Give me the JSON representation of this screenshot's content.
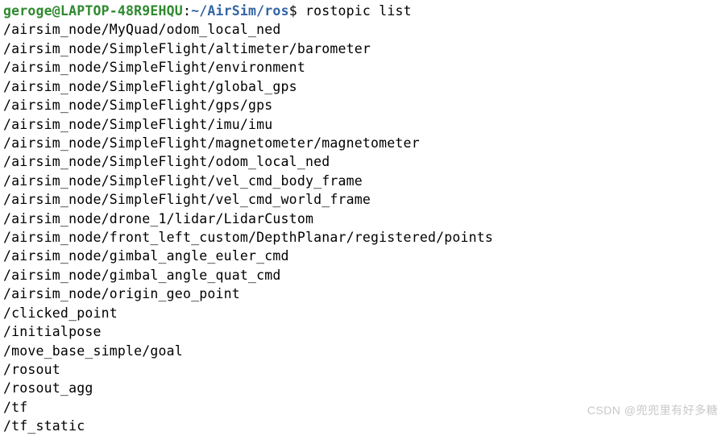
{
  "prompt": {
    "user_host": "geroge@LAPTOP-48R9EHQU",
    "colon": ":",
    "path": "~/AirSim/ros",
    "dollar": "$",
    "command": "rostopic list"
  },
  "topics": [
    "/airsim_node/MyQuad/odom_local_ned",
    "/airsim_node/SimpleFlight/altimeter/barometer",
    "/airsim_node/SimpleFlight/environment",
    "/airsim_node/SimpleFlight/global_gps",
    "/airsim_node/SimpleFlight/gps/gps",
    "/airsim_node/SimpleFlight/imu/imu",
    "/airsim_node/SimpleFlight/magnetometer/magnetometer",
    "/airsim_node/SimpleFlight/odom_local_ned",
    "/airsim_node/SimpleFlight/vel_cmd_body_frame",
    "/airsim_node/SimpleFlight/vel_cmd_world_frame",
    "/airsim_node/drone_1/lidar/LidarCustom",
    "/airsim_node/front_left_custom/DepthPlanar/registered/points",
    "/airsim_node/gimbal_angle_euler_cmd",
    "/airsim_node/gimbal_angle_quat_cmd",
    "/airsim_node/origin_geo_point",
    "/clicked_point",
    "/initialpose",
    "/move_base_simple/goal",
    "/rosout",
    "/rosout_agg",
    "/tf",
    "/tf_static"
  ],
  "watermark": "CSDN @兜兜里有好多糖"
}
